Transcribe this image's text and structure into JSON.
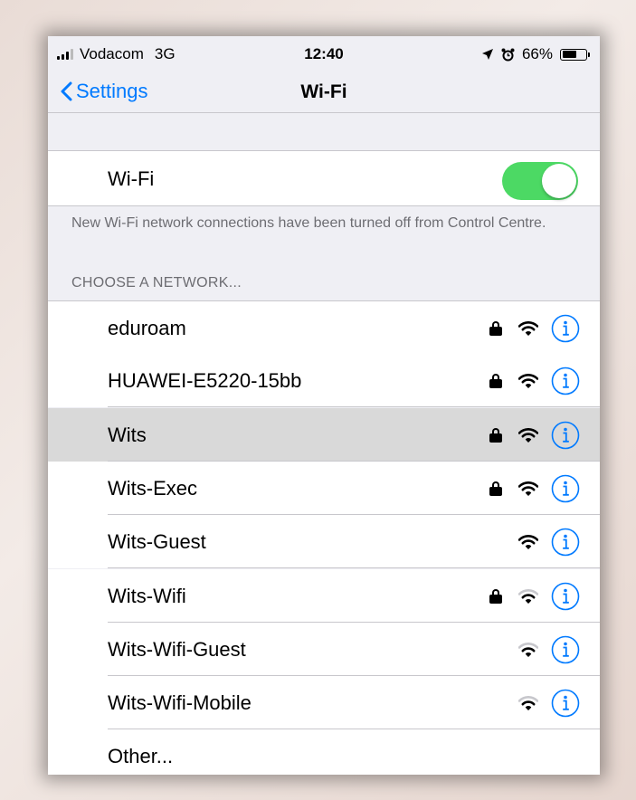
{
  "status_bar": {
    "carrier": "Vodacom",
    "network": "3G",
    "time": "12:40",
    "battery": "66%",
    "battery_level": 0.66,
    "icons": [
      "signal-icon",
      "location-arrow-icon",
      "alarm-clock-icon",
      "battery-icon"
    ]
  },
  "nav": {
    "back_label": "Settings",
    "title": "Wi-Fi"
  },
  "wifi_toggle": {
    "label": "Wi-Fi",
    "on": true,
    "on_color": "#4cd964"
  },
  "note": "New Wi-Fi network connections have been turned off from Control Centre.",
  "section_header": "CHOOSE A NETWORK...",
  "networks": [
    {
      "name": "eduroam",
      "locked": true,
      "strength": 3
    },
    {
      "name": "HUAWEI-E5220-15bb",
      "locked": true,
      "strength": 3
    },
    {
      "name": "Wits",
      "locked": true,
      "strength": 3,
      "selected": true
    },
    {
      "name": "Wits-Exec",
      "locked": true,
      "strength": 3
    },
    {
      "name": "Wits-Guest",
      "locked": false,
      "strength": 3
    },
    {
      "name": "Wits-Wifi",
      "locked": true,
      "strength": 2
    },
    {
      "name": "Wits-Wifi-Guest",
      "locked": false,
      "strength": 2
    },
    {
      "name": "Wits-Wifi-Mobile",
      "locked": false,
      "strength": 2
    }
  ],
  "other_label": "Other...",
  "colors": {
    "accent": "#007aff",
    "background": "#efeff4",
    "selected_row": "#d9d9d9"
  }
}
